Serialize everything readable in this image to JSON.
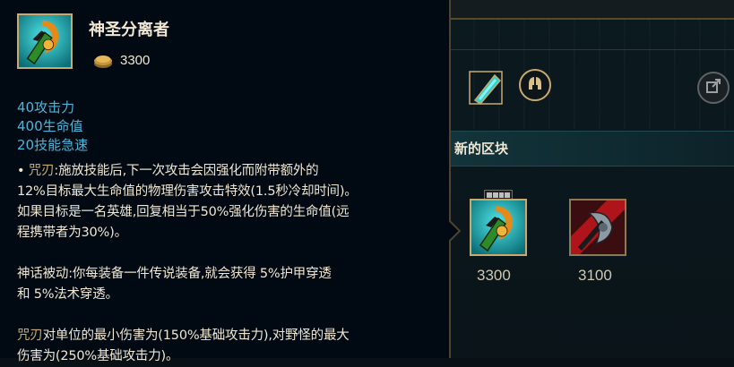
{
  "tooltip": {
    "item_name": "神圣分离者",
    "cost": "3300",
    "stats": [
      "40攻击力",
      "400生命值",
      "20技能急速"
    ],
    "passive_bullet": "•",
    "passive_name": "咒刃",
    "passive_line1": ":施放技能后,下一次攻击会因强化而附带额外的",
    "passive_line2": "12%目标最大生命值的物理伤害攻击特效(1.5秒冷却时间)。",
    "passive_line3": "如果目标是一名英雄,回复相当于50%强化伤害的生命值(远",
    "passive_line4": "程携带者为30%)。",
    "mythic_line1": "神话被动:你每装备一件传说装备,就会获得 5%护甲穿透",
    "mythic_line2": "和 5%法术穿透。",
    "note_keyword": "咒刃",
    "note_line1": "对单位的最小伤害为(150%基础攻击力),对野怪的最大",
    "note_line2": "伤害为(250%基础攻击力)。"
  },
  "shop": {
    "section_title": "新的区块",
    "items": [
      {
        "price": "3300",
        "icon": "divine-sunderer-icon"
      },
      {
        "price": "3100",
        "icon": "black-cleaver-icon"
      }
    ],
    "icons": {
      "tag": "crystal-tag-icon",
      "helmet": "helmet-icon",
      "share": "share-icon"
    }
  },
  "colors": {
    "stat_blue": "#4bb4d9",
    "gold": "#c8aa6e",
    "text": "#f0e6d2",
    "tooltip_bg": "#010a13"
  }
}
